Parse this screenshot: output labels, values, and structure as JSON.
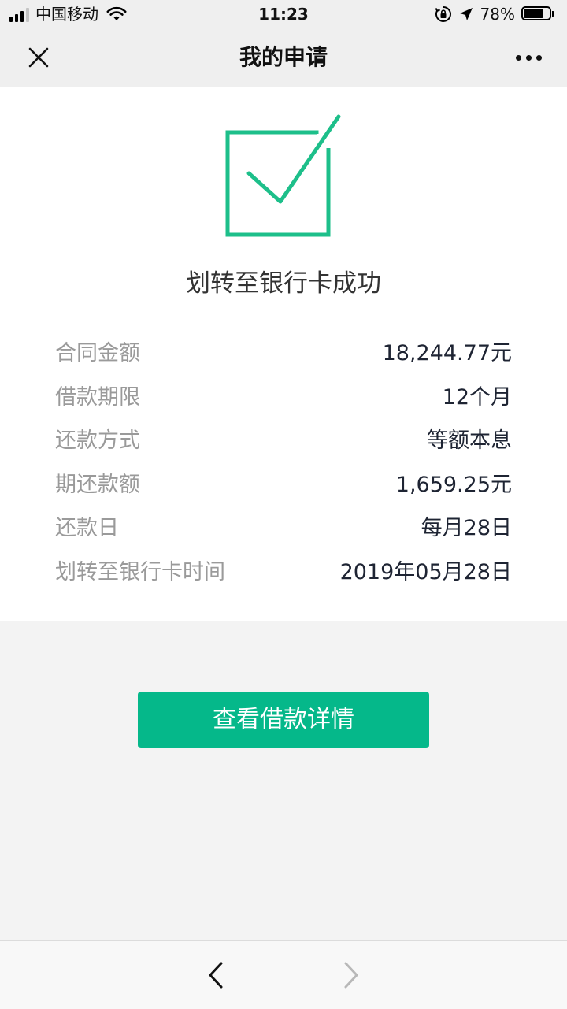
{
  "status_bar": {
    "carrier": "中国移动",
    "time": "11:23",
    "battery_percent": "78%",
    "battery_level": 0.78,
    "icons": [
      "signal-icon",
      "wifi-icon",
      "rotation-lock-icon",
      "location-icon",
      "battery-icon"
    ]
  },
  "nav": {
    "title": "我的申请",
    "close_icon": "close-icon",
    "more_icon": "more-icon"
  },
  "result": {
    "icon": "checkbox-check-icon",
    "accent_color": "#1dbf8a",
    "message": "划转至银行卡成功"
  },
  "details": [
    {
      "label": "合同金额",
      "value": "18,244.77元"
    },
    {
      "label": "借款期限",
      "value": "12个月"
    },
    {
      "label": "还款方式",
      "value": "等额本息"
    },
    {
      "label": "期还款额",
      "value": "1,659.25元"
    },
    {
      "label": "还款日",
      "value": "每月28日"
    },
    {
      "label": "划转至银行卡时间",
      "value": "2019年05月28日"
    }
  ],
  "actions": {
    "view_details_label": "查看借款详情",
    "button_color": "#05b88a"
  },
  "bottom_bar": {
    "back_icon": "chevron-left-icon",
    "forward_icon": "chevron-right-icon"
  }
}
